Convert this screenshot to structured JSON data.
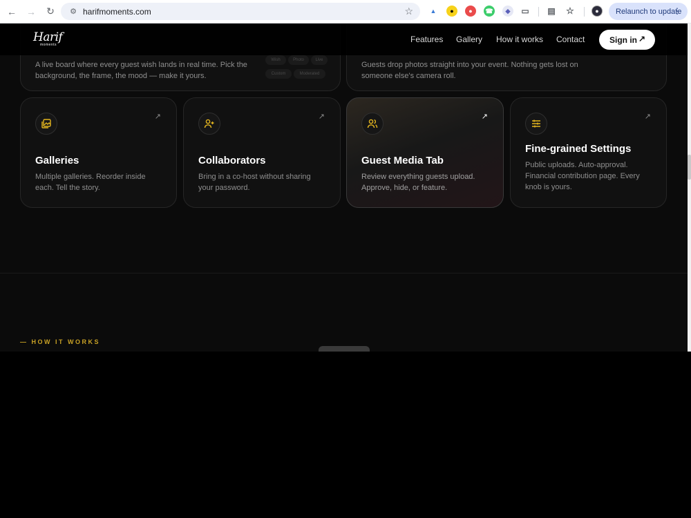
{
  "browser": {
    "url": "harifmoments.com",
    "relaunch_label": "Relaunch to update"
  },
  "header": {
    "logo_text": "Harif",
    "logo_sub": "moments",
    "nav": [
      "Features",
      "Gallery",
      "How it works",
      "Contact"
    ],
    "signin_label": "Sign in"
  },
  "top_cards": [
    {
      "desc_line1": "A live board where every guest wish lands in real time. Pick the",
      "desc_line2": "background, the frame, the mood — make it yours.",
      "chips": [
        "Wish",
        "Photo",
        "Live",
        "Custom",
        "Moderated"
      ]
    },
    {
      "desc_line1": "Guests drop photos straight into your event. Nothing gets lost on",
      "desc_line2": "someone else's camera roll."
    }
  ],
  "features": [
    {
      "title": "Galleries",
      "desc_line1": "Multiple galleries. Reorder inside",
      "desc_line2": "each. Tell the story.",
      "icon": "gallery-icon"
    },
    {
      "title": "Collaborators",
      "desc_line1": "Bring in a co-host without sharing",
      "desc_line2": "your password.",
      "icon": "user-plus-icon"
    },
    {
      "title": "Guest Media Tab",
      "desc_line1": "Review everything guests upload.",
      "desc_line2": "Approve, hide, or feature.",
      "icon": "users-icon"
    },
    {
      "title": "Fine-grained Settings",
      "desc_line1": "Public uploads. Auto-approval.",
      "desc_line2": "Financial contribution page. Every",
      "desc_line3": "knob is yours.",
      "icon": "sliders-icon"
    }
  ],
  "section": {
    "tag": "— HOW IT WORKS"
  },
  "colors": {
    "accent": "#e3b51f",
    "background": "#0b0b0b",
    "card": "#111111"
  }
}
